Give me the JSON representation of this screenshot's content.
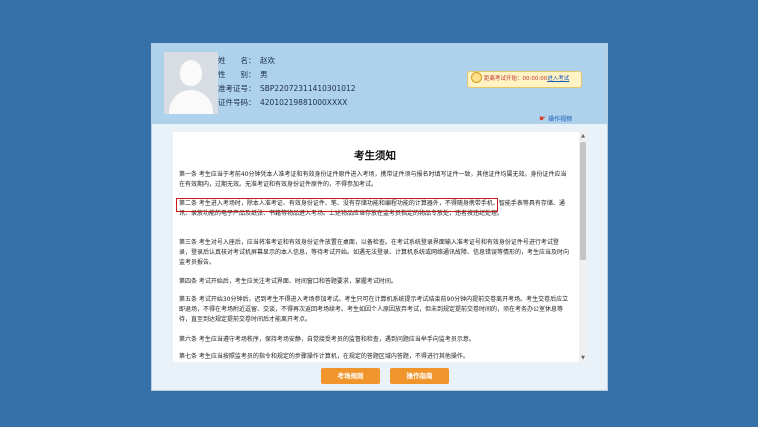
{
  "candidate": {
    "name_label": "姓　　名：",
    "name": "赵欢",
    "gender_label": "性　　别：",
    "gender": "男",
    "ticket_label": "准考证号：",
    "ticket_no": "SBP22072311410301012",
    "id_label": "证件号码：",
    "id_no": "42010219881000XXXX"
  },
  "timer": {
    "label": "距离考试开始：",
    "time": "00:00:00",
    "link": "进入考试",
    "color": "#c0392b"
  },
  "guide_link": "操作视频",
  "notice": {
    "title": "考生须知",
    "paragraphs": [
      "第一条 考生应当于考前40分钟凭本人准考证和有效身份证件原件进入考场，携带证件须与报名时填写证件一致，其他证件均属无效。身份证件应当在有效期内，过期无效。无准考证和有效身份证件原件的，不得参加考试。",
      "第二条 考生进入考场时，除本人准考证、有效身份证件、笔、没有存储功能和编程功能的计算器外，不得随身携带手机、智能手表等具有存储、通讯、录放功能的电子产品及纸张、书籍等物品进入考场。上述物品应当存放在监考员指定的物品专放处，违者按违纪处理。",
      "第三条 考生对号入座后，应当将准考证和有效身份证件放置在桌面，以备检查。在考试系统登录界面输入准考证号和有效身份证件号进行考试登录，登录后认真核对考试机屏幕显示的本人信息，等待考试开始。如遇无法登录、计算机系统或网络通讯故障、信息错误等情形的，考生应当及时向监考员报告。",
      "第四条 考试开始后，考生应关注考试界面、时间窗口和答题要求，掌握考试时间。",
      "第五条 考试开始30分钟后，迟到考生不得进入考场参加考试。考生只可在计算机系统提示考试结束前90分钟内提前交卷离开考场。考生交卷后应立即退场，不得在考场附近逗留、交谈，不得再次返回考场续考。考生如因个人原因放弃考试，但未到规定提前交卷时间的，须在考务办公室休息等待，直至到达规定提前交卷时间后才能离开考点。",
      "第六条 考生应当遵守考场秩序，保持考场安静，自觉接受考员的监督和检查，遇到问题应当举手向监考员示意。",
      "第七条 考生应当按照监考员的指令和规定的步骤操作计算机，在规定的答题区域内答题，不得进行其他操作。"
    ]
  },
  "buttons": {
    "rules": "考场规则",
    "ops": "操作指南"
  },
  "colors": {
    "background": "#3570a8",
    "header": "#aed1ec",
    "button": "#f0952b",
    "highlight": "#d01a1a"
  }
}
